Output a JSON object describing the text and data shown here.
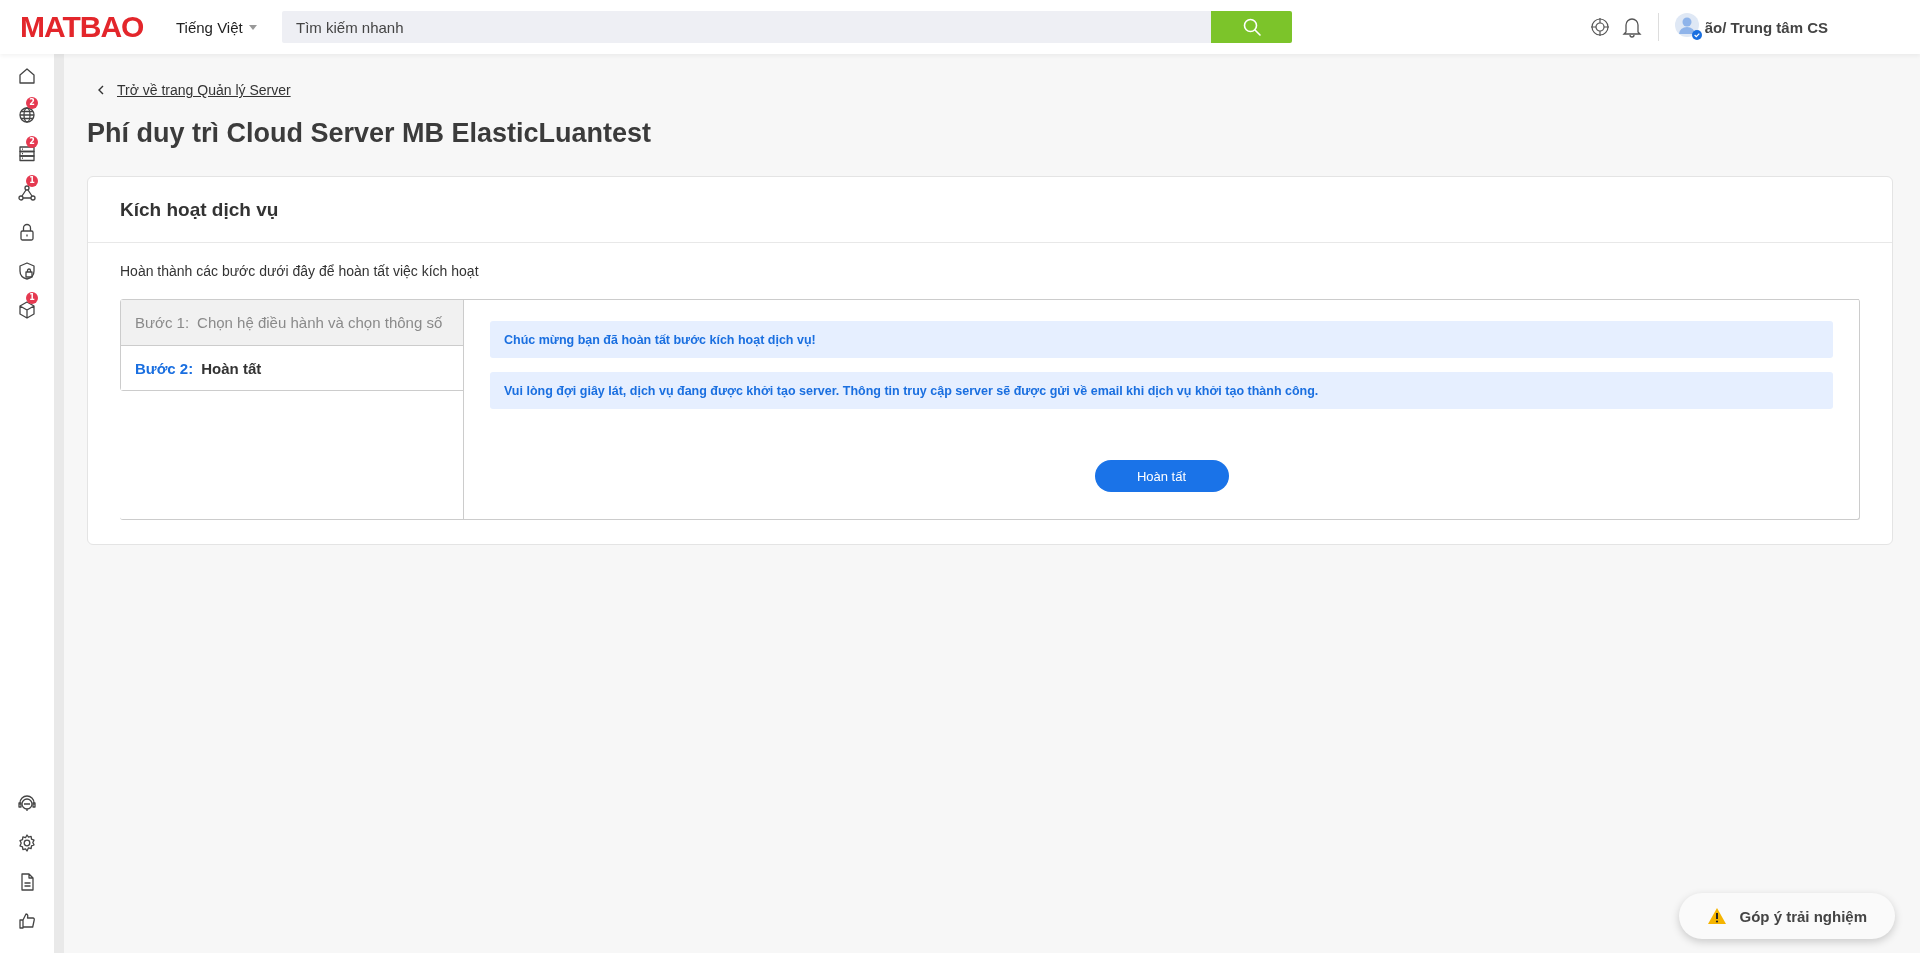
{
  "header": {
    "logo": "MATBAO",
    "language": "Tiếng Việt",
    "search": {
      "placeholder": "Tìm kiếm nhanh"
    },
    "user": "ão/ Trung tâm CS"
  },
  "sidebar": {
    "items": [
      {
        "kind": "home"
      },
      {
        "kind": "globe",
        "badge": "2"
      },
      {
        "kind": "server",
        "badge": "2"
      },
      {
        "kind": "network",
        "badge": "1"
      },
      {
        "kind": "lock"
      },
      {
        "kind": "shield"
      },
      {
        "kind": "box",
        "badge": "1"
      }
    ],
    "bottom_items": [
      {
        "kind": "headset"
      },
      {
        "kind": "gear"
      },
      {
        "kind": "document"
      },
      {
        "kind": "thumb"
      }
    ]
  },
  "breadcrumb": "Trở về trang Quản lý Server",
  "title": "Phí duy trì Cloud Server MB ElasticLuantest",
  "card": {
    "title": "Kích hoạt dịch vụ",
    "description": "Hoàn thành các bước dưới đây để hoàn tất việc kích hoạt",
    "steps": [
      {
        "number": "Bước 1:",
        "label": "Chọn hệ điều hành và chọn thông số",
        "selected": false
      },
      {
        "number": "Bước 2:",
        "label": "Hoàn tất",
        "selected": true
      }
    ],
    "messages": [
      "Chúc mừng bạn đã hoàn tất bước kích hoạt dịch vụ!",
      "Vui lòng đợi giây lát, dịch vụ đang được khởi tạo server. Thông tin truy cập server sẽ được gửi về email khi dịch vụ khởi tạo thành công."
    ],
    "button": "Hoàn tất"
  },
  "feedback": "Góp ý trải nghiệm"
}
